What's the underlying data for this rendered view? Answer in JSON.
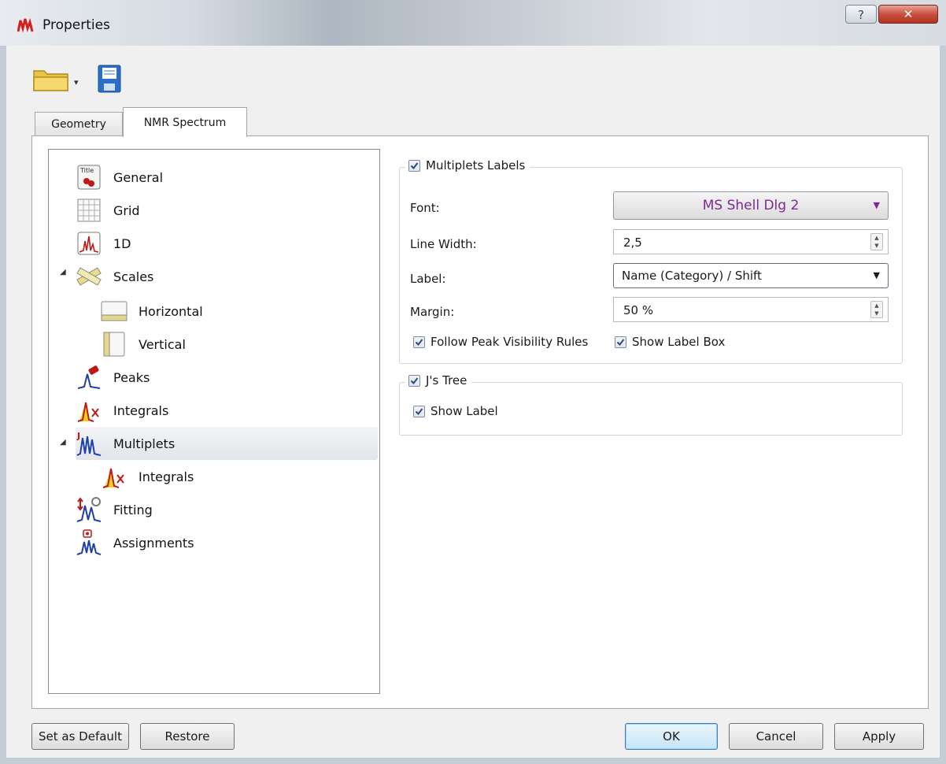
{
  "window": {
    "title": "Properties",
    "help_glyph": "?",
    "close_glyph": "✕"
  },
  "toolbar": {
    "open_icon": "folder-open-icon",
    "dropdown_glyph": "▾",
    "save_icon": "floppy-save-icon"
  },
  "tabs": [
    {
      "label": "Geometry",
      "selected": false
    },
    {
      "label": "NMR Spectrum",
      "selected": true
    }
  ],
  "tree": {
    "expander_glyph": "◢",
    "items": [
      {
        "label": "General",
        "icon": "title-general-icon"
      },
      {
        "label": "Grid",
        "icon": "grid-icon"
      },
      {
        "label": "1D",
        "icon": "spectrum-1d-icon"
      },
      {
        "label": "Scales",
        "icon": "ruler-scales-icon",
        "expanded": true
      },
      {
        "label": "Horizontal",
        "icon": "horizontal-scale-icon"
      },
      {
        "label": "Vertical",
        "icon": "vertical-scale-icon"
      },
      {
        "label": "Peaks",
        "icon": "peaks-icon"
      },
      {
        "label": "Integrals",
        "icon": "integrals-icon"
      },
      {
        "label": "Multiplets",
        "icon": "multiplets-icon",
        "expanded": true,
        "selected": true
      },
      {
        "label": "Integrals",
        "icon": "integrals-icon"
      },
      {
        "label": "Fitting",
        "icon": "fitting-icon"
      },
      {
        "label": "Assignments",
        "icon": "assignments-icon"
      }
    ]
  },
  "multiplets_labels": {
    "title": "Multiplets Labels",
    "checked": true,
    "font_label": "Font:",
    "font_value": "MS Shell Dlg 2",
    "line_width_label": "Line Width:",
    "line_width_value": "2,5",
    "label_label": "Label:",
    "label_value": "Name (Category) / Shift",
    "margin_label": "Margin:",
    "margin_value": "50 %",
    "follow_peak_label": "Follow Peak Visibility Rules",
    "show_label_box_label": "Show Label Box"
  },
  "js_tree": {
    "title": "J's Tree",
    "checked": true,
    "show_label": "Show Label"
  },
  "buttons": {
    "set_default": "Set as Default",
    "restore": "Restore",
    "ok": "OK",
    "cancel": "Cancel",
    "apply": "Apply"
  },
  "colors": {
    "accent_purple": "#7a2a90",
    "close_red": "#c9503f",
    "selection": "#e2e5e9"
  }
}
